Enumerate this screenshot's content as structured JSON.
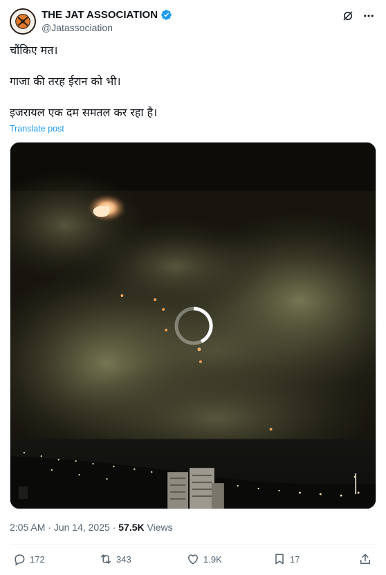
{
  "author": {
    "name": "THE JAT ASSOCIATION",
    "handle": "@Jatassociation"
  },
  "tweet": {
    "lines": [
      "चौंकिए मत।",
      "गाजा की तरह ईरान को भी।",
      "इजरायल एक दम समतल कर रहा है।"
    ],
    "translate_label": "Translate post"
  },
  "meta": {
    "time": "2:05 AM",
    "separator": "·",
    "date": "Jun 14, 2025",
    "views_count": "57.5K",
    "views_label": "Views"
  },
  "actions": {
    "replies": "172",
    "reposts": "343",
    "likes": "1.9K",
    "bookmarks": "17"
  },
  "icons": {
    "verified": "verified-badge-icon",
    "grok": "grok-icon",
    "more": "more-options-icon",
    "loading": "loading-spinner-icon",
    "reply": "reply-icon",
    "repost": "repost-icon",
    "like": "like-icon",
    "bookmark": "bookmark-icon",
    "share": "share-icon"
  },
  "colors": {
    "accent": "#1d9bf0",
    "text": "#0f1419",
    "muted": "#536471"
  }
}
